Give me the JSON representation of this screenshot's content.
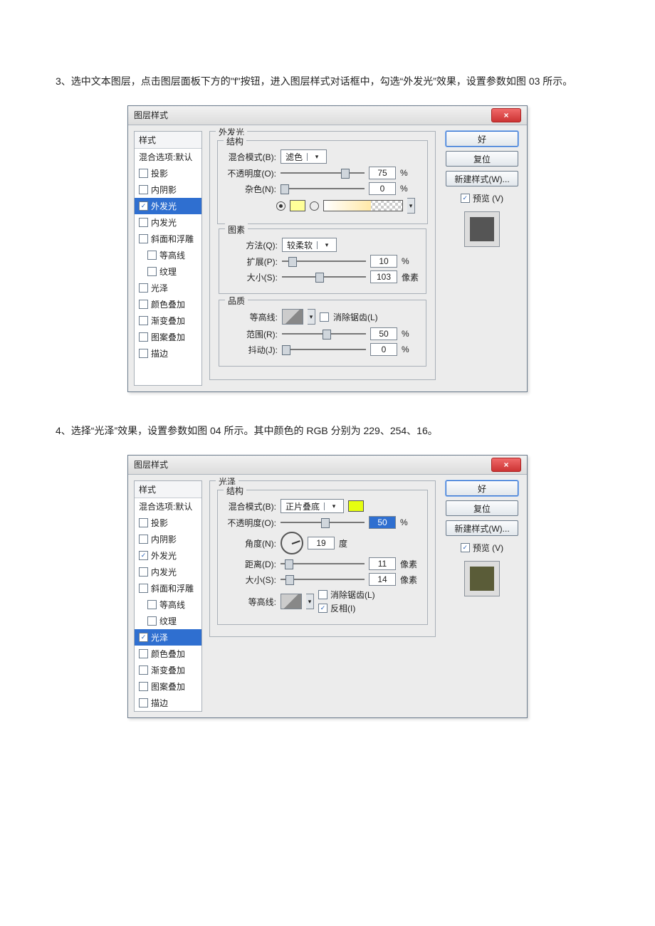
{
  "paragraphs": {
    "p1": "3、选中文本图层，点击图层面板下方的\"f\"按钮，进入图层样式对话框中，勾选“外发光”效果，设置参数如图 03 所示。",
    "p2": "4、选择“光泽”效果，设置参数如图 04 所示。其中颜色的 RGB 分别为 229、254、16。"
  },
  "common": {
    "title": "图层样式",
    "close": "×",
    "ok": "好",
    "reset": "复位",
    "newStyle": "新建样式(W)...",
    "preview": "预览 (V)",
    "stylesHeader": "样式",
    "blendDefault": "混合选项:默认",
    "styleItems": [
      "投影",
      "内阴影",
      "外发光",
      "内发光",
      "斜面和浮雕",
      "等高线",
      "纹理",
      "光泽",
      "颜色叠加",
      "渐变叠加",
      "图案叠加",
      "描边"
    ],
    "labels": {
      "blendMode": "混合模式(B):",
      "opacity": "不透明度(O):",
      "noise": "杂色(N):",
      "technique": "方法(Q):",
      "spread": "扩展(P):",
      "size": "大小(S):",
      "contour": "等高线:",
      "antialias": "消除锯齿(L)",
      "range": "范围(R):",
      "jitter": "抖动(J):",
      "angle": "角度(N):",
      "distance": "距离(D):",
      "invert": "反相(I)",
      "percent": "%",
      "px": "像素",
      "deg": "度"
    },
    "groups": {
      "outerGlow": "外发光",
      "structure": "结构",
      "elements": "图素",
      "quality": "品质",
      "satin": "光泽"
    }
  },
  "dlg1": {
    "selected": "外发光",
    "checked": [
      "外发光"
    ],
    "blendMode": "滤色",
    "opacity": "75",
    "noise": "0",
    "technique": "较柔软",
    "spread": "10",
    "size": "103",
    "range": "50",
    "jitter": "0",
    "previewColor": "#555"
  },
  "dlg2": {
    "selected": "光泽",
    "checked": [
      "外发光",
      "光泽"
    ],
    "blendMode": "正片叠底",
    "swatch": "#e5fe10",
    "opacity": "50",
    "angle": "19",
    "distance": "11",
    "size": "14",
    "invertChecked": true,
    "previewColor": "#5a5c38"
  }
}
